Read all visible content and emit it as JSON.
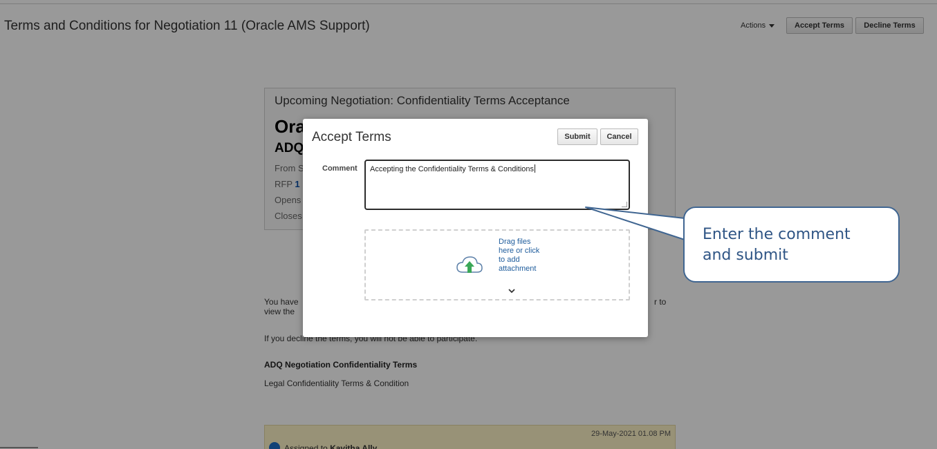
{
  "header": {
    "page_title": "Terms and Conditions for Negotiation 11 (Oracle AMS Support)",
    "actions_label": "Actions",
    "accept_terms_label": "Accept Terms",
    "decline_terms_label": "Decline Terms"
  },
  "card": {
    "heading": "Upcoming Negotiation: Confidentiality Terms Acceptance",
    "title_fragment": "Ora",
    "subtitle_fragment": "ADQ",
    "from_fragment": "From S",
    "rfp_label": "RFP",
    "rfp_value_fragment": "1",
    "opens_fragment": "Opens",
    "closes_fragment": "Closes"
  },
  "body": {
    "para1_left": "You have",
    "para1_right": "r to",
    "para1_line2": "view the",
    "para2": "If you decline the terms, you will not be able to participate.",
    "terms_heading": "ADQ Negotiation Confidentiality Terms",
    "terms_text": "Legal Confidentiality Terms & Condition"
  },
  "history": {
    "date": "29-May-2021 01.08 PM",
    "text_prefix": "Assigned to",
    "assignee": "Kavitha Ally"
  },
  "modal": {
    "title": "Accept Terms",
    "submit_label": "Submit",
    "cancel_label": "Cancel",
    "comment_label": "Comment",
    "comment_value": "Accepting the Confidentiality Terms & Conditions",
    "dropzone_text": "Drag files here or click to add attachment"
  },
  "callout": {
    "text": "Enter the comment and submit"
  },
  "colors": {
    "overlay": "#000000",
    "callout_border": "#3f6591",
    "callout_text": "#2f5585",
    "link_blue": "#1e5c9c",
    "upload_green": "#3aa757",
    "history_bg": "#fdf3c7"
  },
  "icons": {
    "actions_dropdown": "triangle-down-icon",
    "upload": "cloud-upload-icon",
    "expand": "chevron-down-icon",
    "history": "info-circle-icon"
  }
}
